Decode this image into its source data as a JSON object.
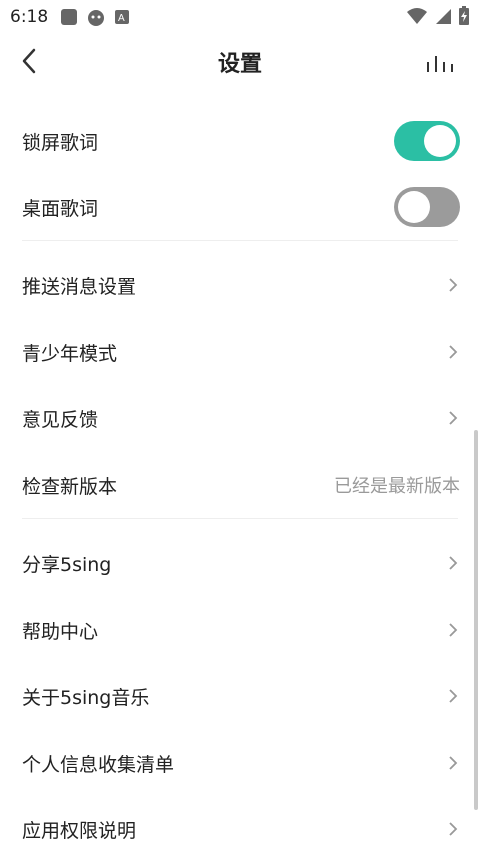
{
  "status_bar": {
    "time": "6:18"
  },
  "header": {
    "title": "设置"
  },
  "settings": {
    "lock_screen_lyrics": {
      "label": "锁屏歌词",
      "on": true
    },
    "desktop_lyrics": {
      "label": "桌面歌词",
      "on": false
    },
    "push_settings": {
      "label": "推送消息设置"
    },
    "teen_mode": {
      "label": "青少年模式"
    },
    "feedback": {
      "label": "意见反馈"
    },
    "check_update": {
      "label": "检查新版本",
      "status": "已经是最新版本"
    },
    "share": {
      "label": "分享5sing"
    },
    "help": {
      "label": "帮助中心"
    },
    "about": {
      "label": "关于5sing音乐"
    },
    "personal_info": {
      "label": "个人信息收集清单"
    },
    "permissions": {
      "label": "应用权限说明"
    }
  },
  "colors": {
    "accent": "#2bbfa4",
    "text": "#222222",
    "muted": "#9a9a9a"
  }
}
